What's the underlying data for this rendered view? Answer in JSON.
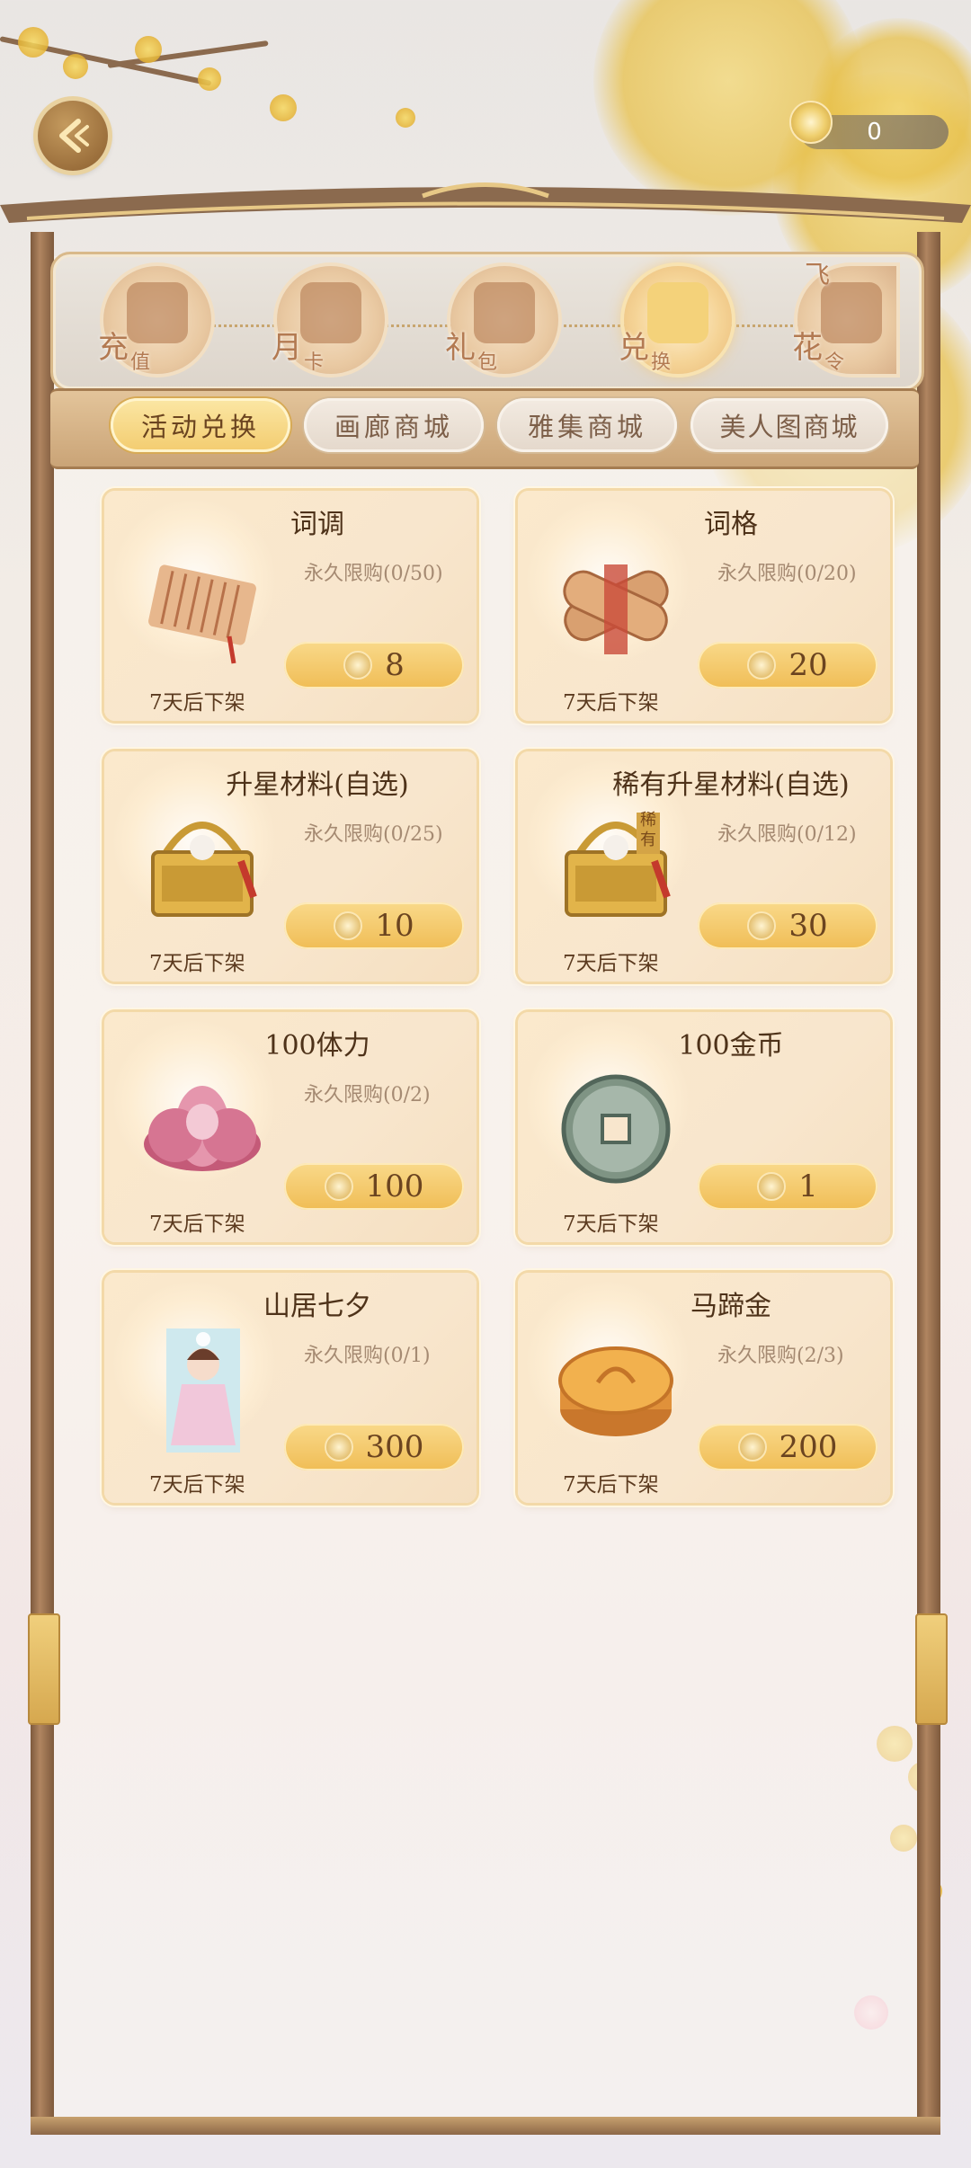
{
  "header": {
    "back_icon": "back-arrow-icon",
    "currency_value": "0",
    "currency_icon": "flower-token-icon"
  },
  "categories": [
    {
      "label_main": "充",
      "label_sub": "值",
      "icon": "coin-icon",
      "active": false
    },
    {
      "label_main": "月",
      "label_sub": "卡",
      "icon": "card-icon",
      "active": false
    },
    {
      "label_main": "礼",
      "label_sub": "包",
      "icon": "gift-box-icon",
      "active": false
    },
    {
      "label_main": "兑",
      "label_sub": "换",
      "icon": "exchange-gift-icon",
      "active": true
    },
    {
      "label_main": "花",
      "label_sub": "令",
      "icon": "flower-order-icon",
      "active": false
    }
  ],
  "cat_extra": {
    "top_char": "飞"
  },
  "tabs": [
    {
      "label": "活动兑换",
      "active": true
    },
    {
      "label": "画廊商城",
      "active": false
    },
    {
      "label": "雅集商城",
      "active": false
    },
    {
      "label": "美人图商城",
      "active": false
    }
  ],
  "items": [
    {
      "name": "词调",
      "limit": "永久限购(0/50)",
      "price": "8",
      "expire": "7天后下架",
      "icon": "scroll-icon"
    },
    {
      "name": "词格",
      "limit": "永久限购(0/20)",
      "price": "20",
      "expire": "7天后下架",
      "icon": "bamboo-scroll-icon"
    },
    {
      "name": "升星材料(自选)",
      "limit": "永久限购(0/25)",
      "price": "10",
      "expire": "7天后下架",
      "icon": "basket-icon"
    },
    {
      "name": "稀有升星材料(自选)",
      "limit": "永久限购(0/12)",
      "price": "30",
      "expire": "7天后下架",
      "icon": "rare-basket-icon",
      "tag": "稀有"
    },
    {
      "name": "100体力",
      "limit": "永久限购(0/2)",
      "price": "100",
      "expire": "7天后下架",
      "icon": "lotus-icon"
    },
    {
      "name": "100金币",
      "limit": "",
      "price": "1",
      "expire": "7天后下架",
      "icon": "jade-coin-icon"
    },
    {
      "name": "山居七夕",
      "limit": "永久限购(0/1)",
      "price": "300",
      "expire": "7天后下架",
      "icon": "costume-portrait-icon"
    },
    {
      "name": "马蹄金",
      "limit": "永久限购(2/3)",
      "price": "200",
      "expire": "7天后下架",
      "icon": "gold-ingot-icon"
    }
  ],
  "colors": {
    "accent": "#f0bd55",
    "frame": "#8b6a4e",
    "text_dark": "#4e3219"
  }
}
